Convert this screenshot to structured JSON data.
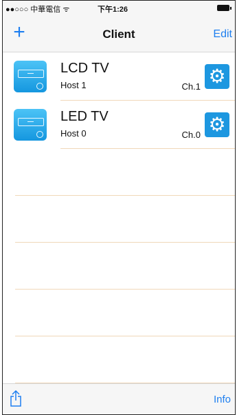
{
  "status_bar": {
    "carrier": "●●○○○ 中華電信 ᯤ",
    "time": "下午1:26"
  },
  "nav": {
    "title": "Client",
    "edit_label": "Edit",
    "add_icon": "plus-icon"
  },
  "clients": [
    {
      "name": "LCD TV",
      "host": "Host 1",
      "channel": "Ch.1",
      "icon": "tv-icon",
      "action_icon": "gear-icon"
    },
    {
      "name": "LED TV",
      "host": "Host 0",
      "channel": "Ch.0",
      "icon": "tv-icon",
      "action_icon": "gear-icon"
    }
  ],
  "toolbar": {
    "share_icon": "share-icon",
    "info_label": "Info"
  },
  "colors": {
    "accent": "#1e7ff0",
    "gear_button": "#1d97e0",
    "divider": "#f0d8b9",
    "bar_background": "#f6f6f6"
  }
}
